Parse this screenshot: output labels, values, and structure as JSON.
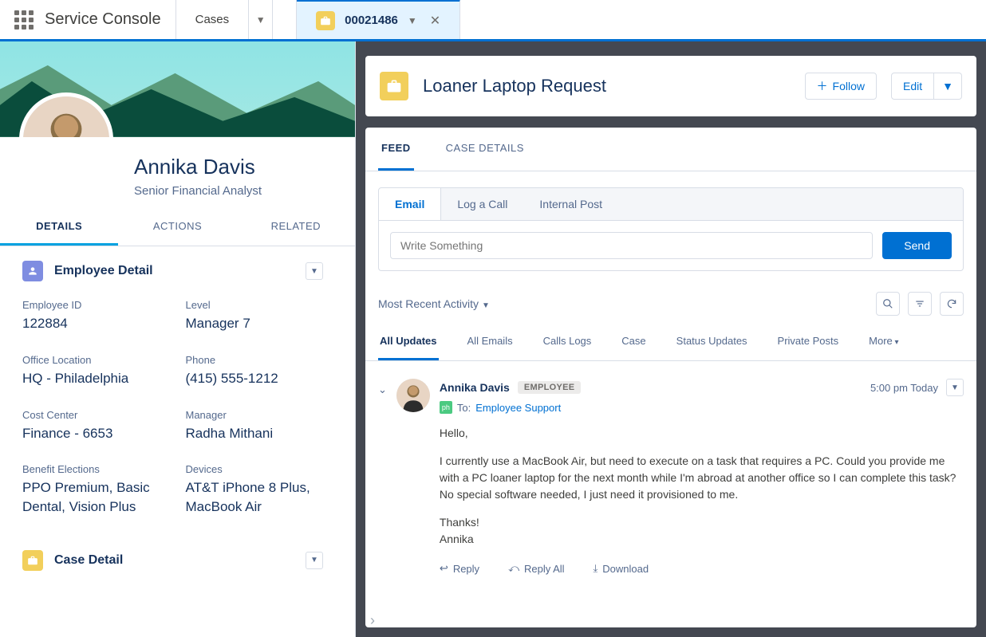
{
  "topbar": {
    "app_name": "Service Console",
    "nav_cases": "Cases",
    "tab_number": "00021486"
  },
  "person": {
    "name": "Annika Davis",
    "title": "Senior Financial Analyst"
  },
  "left_tabs": {
    "details": "DETAILS",
    "actions": "ACTIONS",
    "related": "RELATED"
  },
  "employee_section": {
    "title": "Employee Detail",
    "fields": {
      "emp_id_label": "Employee ID",
      "emp_id": "122884",
      "level_label": "Level",
      "level": "Manager 7",
      "office_label": "Office Location",
      "office": "HQ - Philadelphia",
      "phone_label": "Phone",
      "phone": "(415) 555-1212",
      "cost_label": "Cost Center",
      "cost": "Finance - 6653",
      "mgr_label": "Manager",
      "mgr": "Radha Mithani",
      "benefit_label": "Benefit Elections",
      "benefit": "PPO Premium, Basic Dental, Vision Plus",
      "devices_label": "Devices",
      "devices": "AT&T iPhone 8 Plus, MacBook Air"
    }
  },
  "case_section": {
    "title": "Case Detail"
  },
  "page_header": {
    "title": "Loaner Laptop Request",
    "follow": "Follow",
    "edit": "Edit"
  },
  "record_tabs": {
    "feed": "FEED",
    "case_details": "CASE DETAILS"
  },
  "composer": {
    "tabs": {
      "email": "Email",
      "log": "Log a Call",
      "post": "Internal Post"
    },
    "placeholder": "Write Something",
    "send": "Send"
  },
  "sort_label": "Most Recent Activity",
  "filter_tabs": {
    "all": "All Updates",
    "emails": "All Emails",
    "calls": "Calls Logs",
    "case": "Case",
    "status": "Status Updates",
    "posts": "Private Posts",
    "more": "More"
  },
  "feed_item": {
    "author": "Annika Davis",
    "badge": "EMPLOYEE",
    "time": "5:00 pm Today",
    "to_label": "To:",
    "to_recipient": "Employee Support",
    "greeting": "Hello,",
    "body": "I currently use a MacBook Air, but need to execute on a task that requires a PC.  Could you provide me with a PC loaner laptop for the next month while I'm abroad at another office so I can complete this task?  No special software needed, I just need it provisioned to me.",
    "thanks": "Thanks!",
    "signature": "Annika",
    "actions": {
      "reply": "Reply",
      "reply_all": "Reply All",
      "download": "Download"
    }
  }
}
